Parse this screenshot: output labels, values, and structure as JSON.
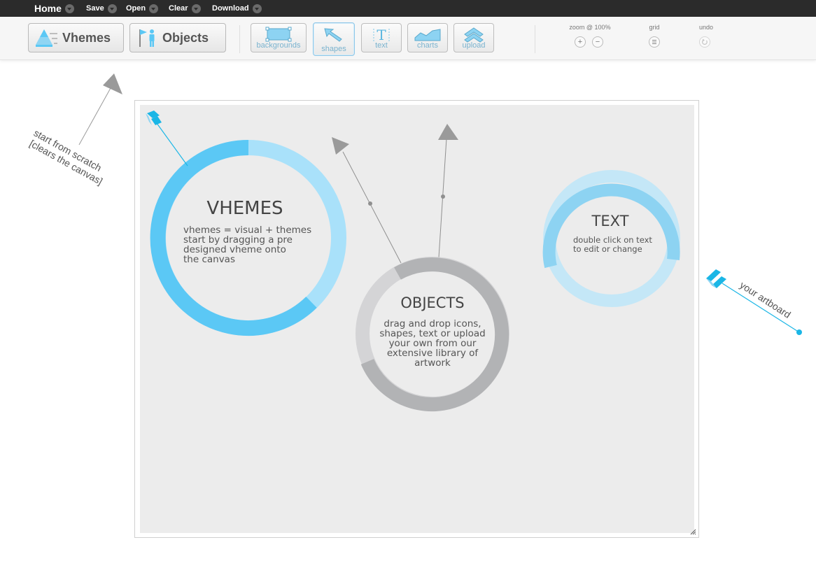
{
  "menu": {
    "home": "Home",
    "save": "Save",
    "open": "Open",
    "clear": "Clear",
    "download": "Download"
  },
  "toolbar": {
    "vhemes_label": "Vhemes",
    "objects_label": "Objects",
    "tools": {
      "backgrounds": "backgrounds",
      "shapes": "shapes",
      "text": "text",
      "charts": "charts",
      "upload": "upload"
    },
    "zoom_label": "zoom @ 100%",
    "grid_label": "grid",
    "undo_label": "undo",
    "active_tool": "shapes"
  },
  "annotations": {
    "start_line1": "start from scratch",
    "start_line2": "[clears the canvas]",
    "artboard_label": "your artboard"
  },
  "canvas": {
    "vhemes": {
      "title": "VHEMES",
      "lines": [
        "vhemes = visual + themes",
        "start by dragging a pre",
        "designed vheme onto",
        "the canvas"
      ]
    },
    "objects": {
      "title": "OBJECTS",
      "lines": [
        "drag and drop icons,",
        "shapes, text or upload",
        "your own from our",
        "extensive library of",
        "artwork"
      ]
    },
    "text": {
      "title": "TEXT",
      "lines": [
        "double click on text",
        "to edit or change"
      ]
    }
  },
  "colors": {
    "accent_blue": "#5bc8f5",
    "light_blue": "#a9e1fa",
    "text_ring": "#8dd3f2",
    "text_ring_light": "#c4e7f7",
    "objects_dark": "#b2b3b5",
    "objects_light": "#d4d4d6",
    "arrow_gray": "#9a9a9a",
    "annotation_cyan": "#1ab6e6"
  }
}
